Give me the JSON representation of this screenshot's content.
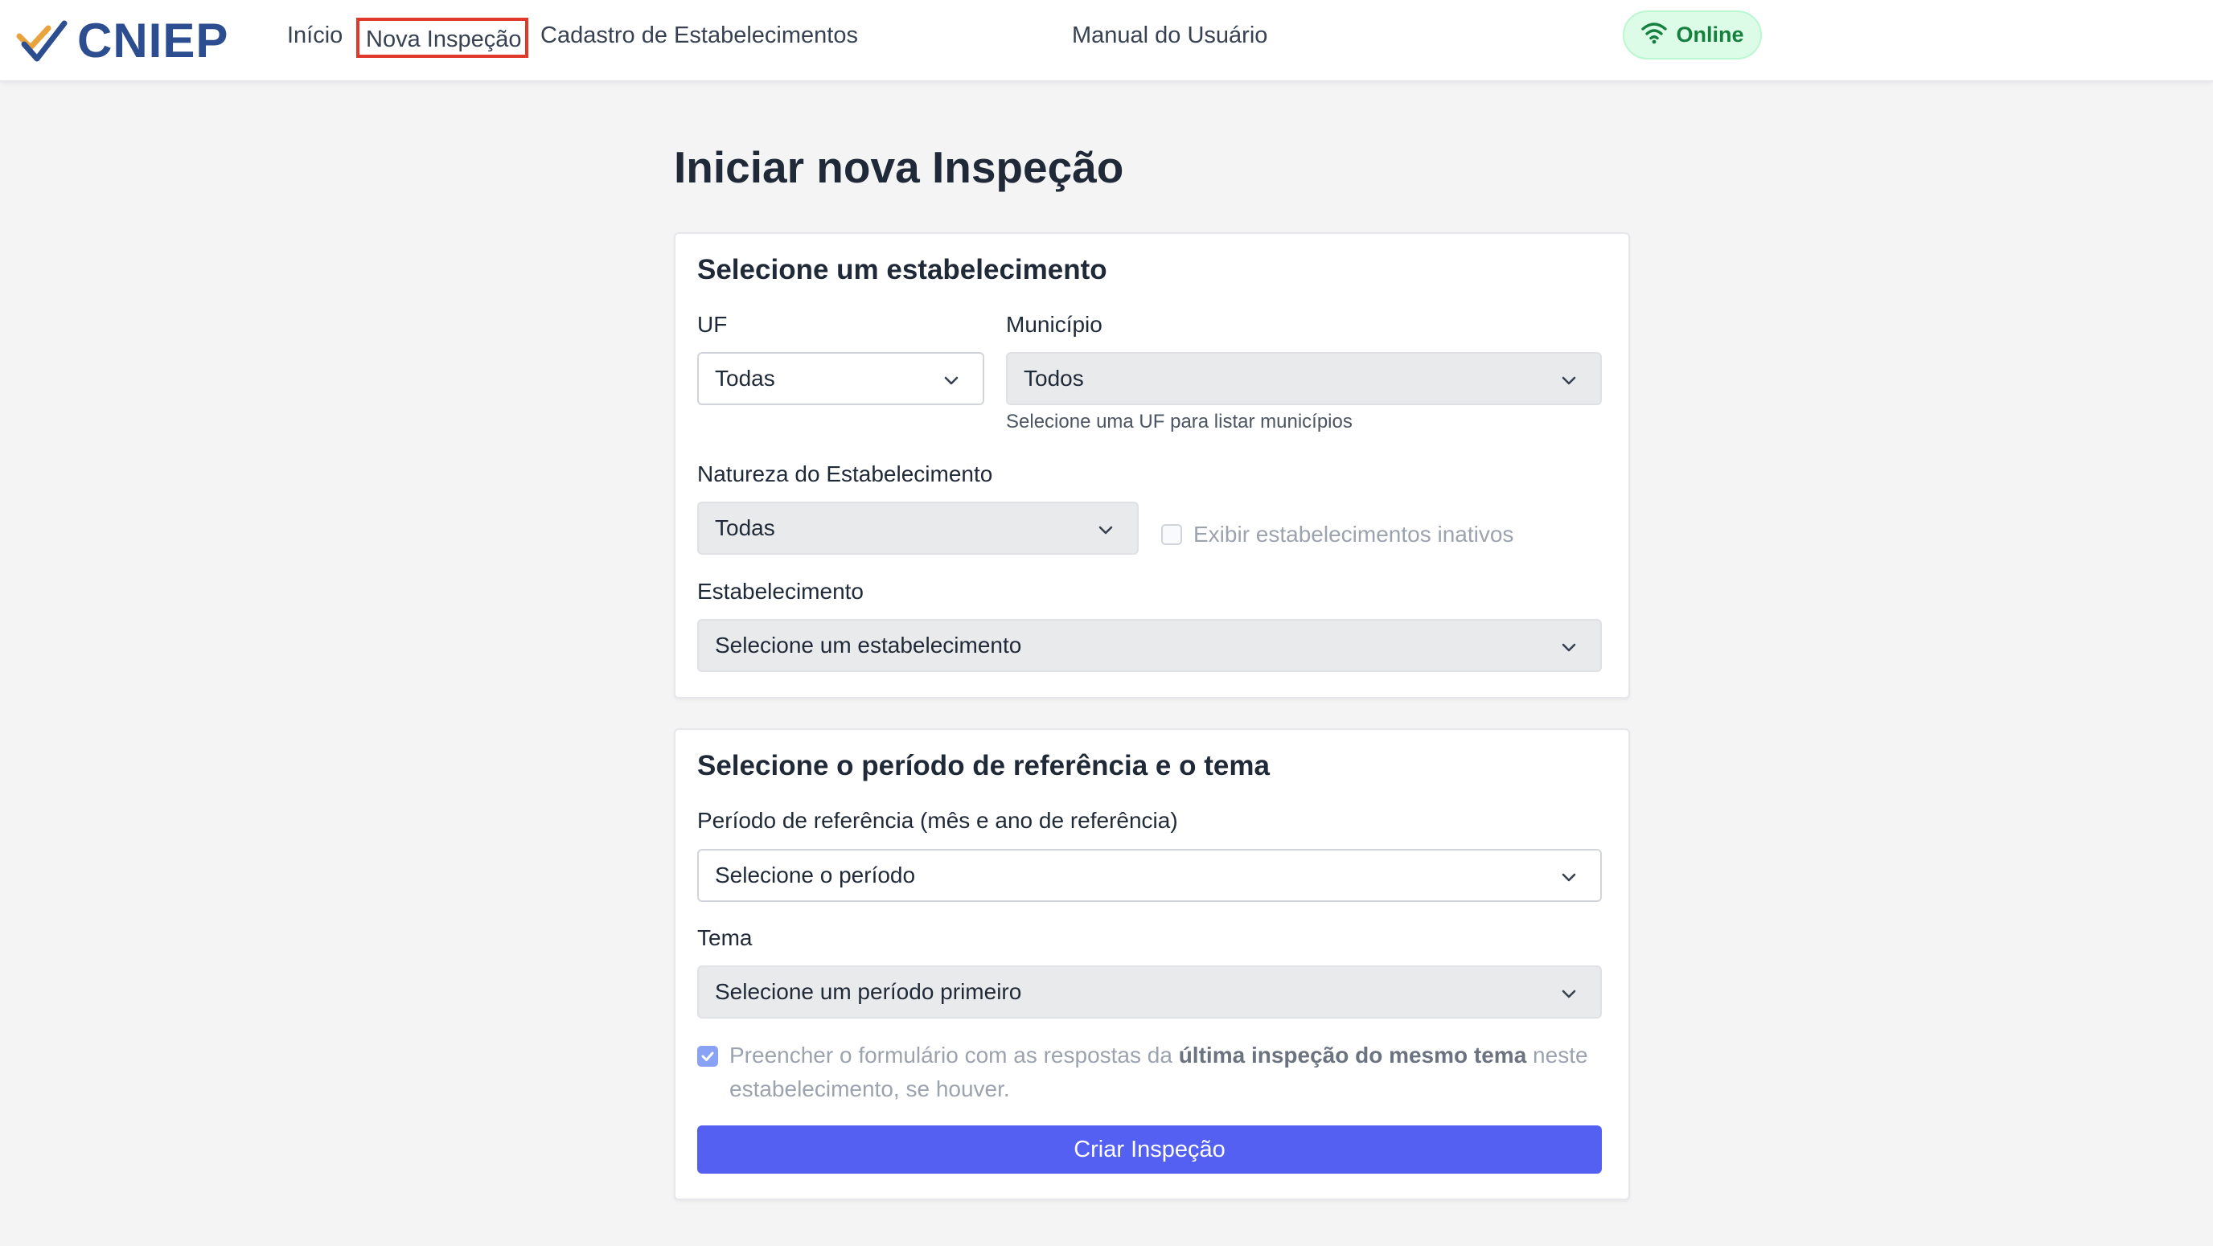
{
  "brand": {
    "name": "CNIEP",
    "logo_icon": "double-check-chart-icon",
    "color": "#2c4d8f"
  },
  "nav": {
    "inicio": "Início",
    "nova_inspecao": "Nova Inspeção",
    "cadastro": "Cadastro de Estabelecimentos",
    "manual": "Manual do Usuário"
  },
  "status": {
    "label": "Online",
    "icon": "wifi-icon",
    "color": "#15803d"
  },
  "page": {
    "title": "Iniciar nova Inspeção"
  },
  "estabelecimento_card": {
    "title": "Selecione um estabelecimento",
    "uf": {
      "label": "UF",
      "value": "Todas"
    },
    "municipio": {
      "label": "Município",
      "value": "Todos",
      "hint": "Selecione uma UF para listar municípios"
    },
    "natureza": {
      "label": "Natureza do Estabelecimento",
      "value": "Todas"
    },
    "inativos": {
      "label": "Exibir estabelecimentos inativos",
      "checked": false
    },
    "estabelecimento": {
      "label": "Estabelecimento",
      "value": "Selecione um estabelecimento"
    }
  },
  "periodo_card": {
    "title": "Selecione o período de referência e o tema",
    "periodo": {
      "label": "Período de referência (mês e ano de referência)",
      "value": "Selecione o período"
    },
    "tema": {
      "label": "Tema",
      "value": "Selecione um período primeiro"
    },
    "prefill": {
      "checked": true,
      "text_before": "Preencher o formulário com as respostas da ",
      "text_bold": "última inspeção do mesmo tema",
      "text_after": " neste estabelecimento, se houver."
    },
    "submit_label": "Criar Inspeção"
  },
  "colors": {
    "accent": "#5460f2",
    "highlight": "#e0392b"
  }
}
